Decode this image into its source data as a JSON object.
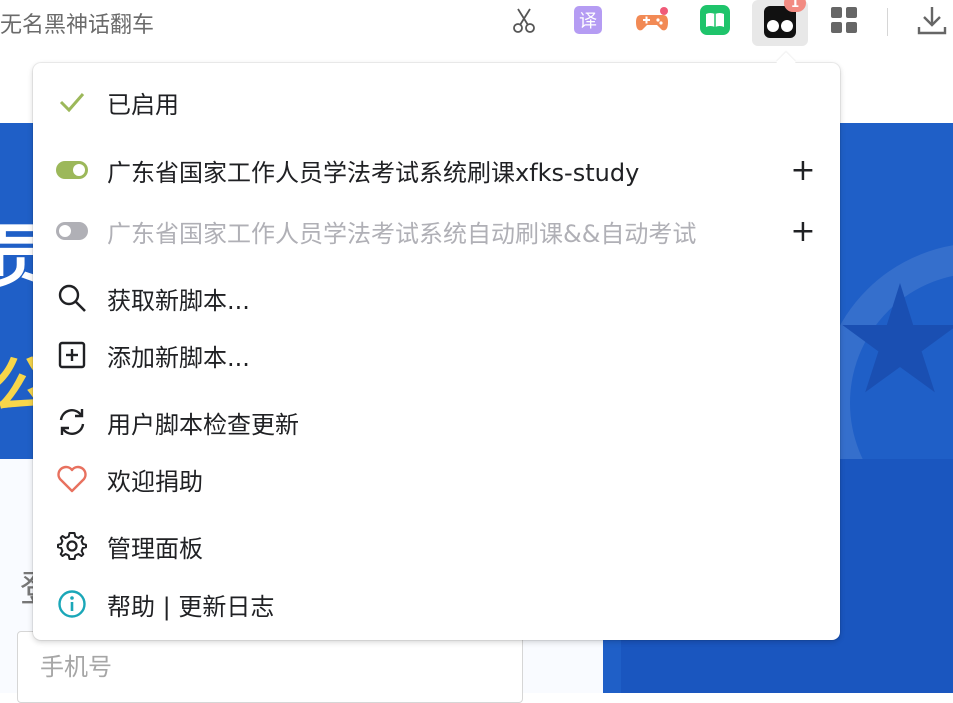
{
  "tab": {
    "title": "无名黑神话翻车"
  },
  "toolbar": {
    "icons": [
      "scissors-icon",
      "translate-icon",
      "game-icon",
      "book-icon",
      "tampermonkey-icon",
      "apps-grid-icon",
      "download-icon"
    ],
    "translate_glyph": "译",
    "badge_count": "1"
  },
  "popup": {
    "enabled_label": "已启用",
    "scripts": [
      {
        "label": "广东省国家工作人员学法考试系统刷课xfks-study",
        "enabled": true
      },
      {
        "label": "广东省国家工作人员学法考试系统自动刷课&&自动考试",
        "enabled": false
      }
    ],
    "plus_glyph": "+",
    "items": [
      {
        "label": "获取新脚本...",
        "icon": "search-icon"
      },
      {
        "label": "添加新脚本...",
        "icon": "add-box-icon"
      },
      {
        "label": "用户脚本检查更新",
        "icon": "refresh-icon"
      },
      {
        "label": "欢迎捐助",
        "icon": "heart-icon"
      },
      {
        "label": "管理面板",
        "icon": "gear-icon"
      },
      {
        "label": "帮助 | 更新日志",
        "icon": "info-icon"
      }
    ]
  },
  "page": {
    "phone_placeholder": "手机号"
  },
  "colors": {
    "accent_green": "#9cb85a",
    "heart": "#e8715f",
    "info": "#1aa7b8",
    "hero_blue": "#1f5fc7"
  }
}
